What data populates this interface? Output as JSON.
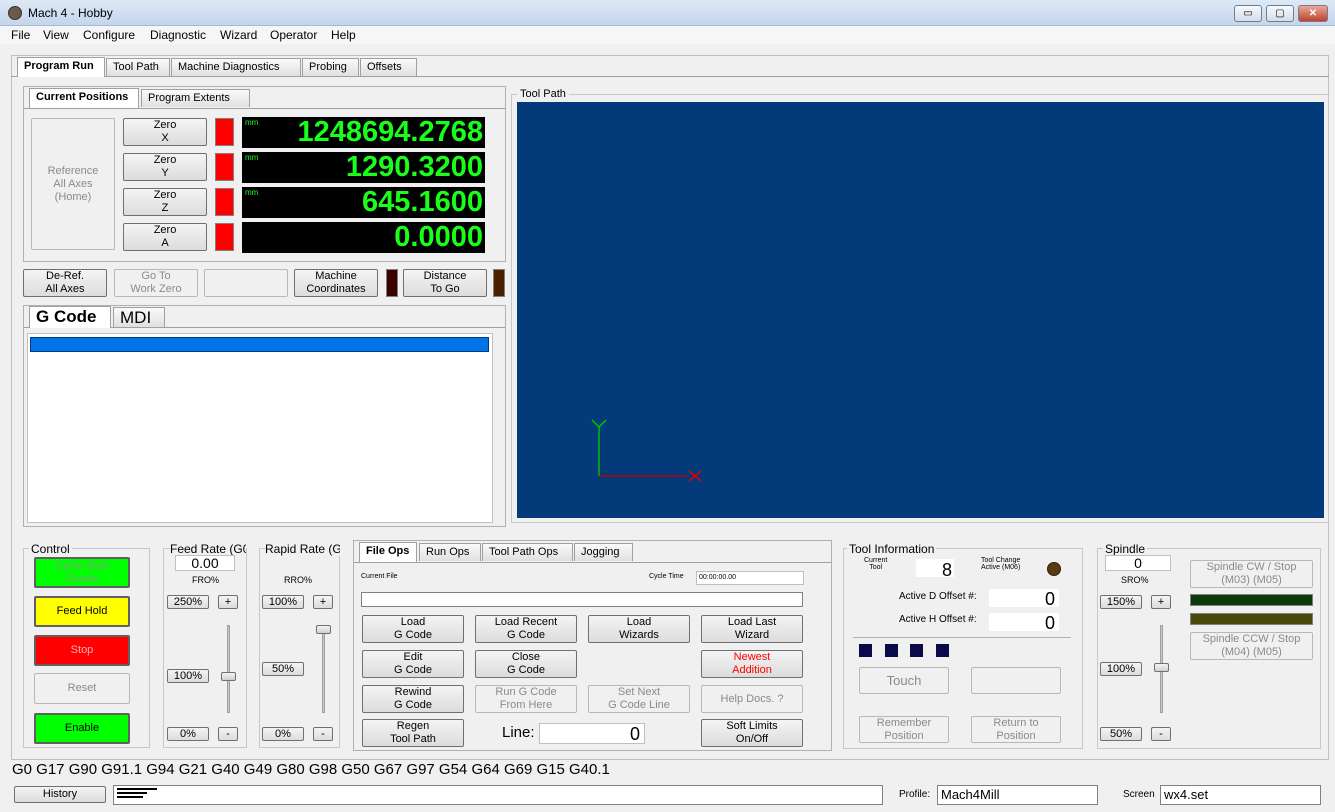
{
  "window": {
    "title": "Mach 4 - Hobby",
    "min": "▭",
    "max": "▢",
    "close": "✕"
  },
  "menu": [
    "File",
    "View",
    "Configure",
    "Diagnostic",
    "Wizard",
    "Operator",
    "Help"
  ],
  "main_tabs": [
    "Program Run",
    "Tool Path",
    "Machine Diagnostics",
    "Probing",
    "Offsets"
  ],
  "positions": {
    "tabs": [
      "Current Positions",
      "Program Extents"
    ],
    "reference_btn": "Reference\nAll Axes\n(Home)",
    "axes": [
      {
        "zero": "Zero\nX",
        "unit": "mm",
        "value": "1248694.2768"
      },
      {
        "zero": "Zero\nY",
        "unit": "mm",
        "value": "1290.3200"
      },
      {
        "zero": "Zero\nZ",
        "unit": "mm",
        "value": "645.1600"
      },
      {
        "zero": "Zero\nA",
        "unit": "",
        "value": "0.0000"
      }
    ],
    "deref": "De-Ref.\nAll Axes",
    "goto": "Go To\nWork Zero",
    "machine": "Machine\nCoordinates",
    "distance": "Distance\nTo Go"
  },
  "gcode": {
    "tabs": [
      "G Code",
      "MDI"
    ]
  },
  "toolpath_label": "Tool Path",
  "colors": {
    "toolpath_bg": "#033b7a",
    "dro_text": "#1aff1a"
  },
  "control": {
    "title": "Control",
    "cycle": "Cycle Start\nGcode",
    "hold": "Feed Hold",
    "stop": "Stop",
    "reset": "Reset",
    "enable": "Enable"
  },
  "feed": {
    "title": "Feed Rate (G0",
    "value": "0.00",
    "unit": "FRO%",
    "max": "250%",
    "mid": "100%",
    "min": "0%",
    "plus": "+",
    "minus": "-"
  },
  "rapid": {
    "title": "Rapid Rate (G",
    "unit": "RRO%",
    "max": "100%",
    "mid": "50%",
    "min": "0%",
    "plus": "+",
    "minus": "-"
  },
  "fileops": {
    "tabs": [
      "File Ops",
      "Run Ops",
      "Tool Path Ops",
      "Jogging"
    ],
    "current_file": "Current File",
    "cycle_time": "Cycle Time",
    "cycle_value": "00:00:00.00",
    "load": "Load\nG Code",
    "load_recent": "Load Recent\nG Code",
    "load_wizards": "Load\nWizards",
    "load_last": "Load Last\nWizard",
    "edit": "Edit\nG Code",
    "close": "Close\nG Code",
    "newest": "Newest\nAddition",
    "rewind": "Rewind\nG Code",
    "run_from": "Run G Code\nFrom Here",
    "set_next": "Set Next\nG Code Line",
    "help": "Help Docs. ?",
    "regen": "Regen\nTool Path",
    "line_label": "Line:",
    "line_value": "0",
    "soft_limits": "Soft Limits\nOn/Off"
  },
  "tool": {
    "title": "Tool Information",
    "current_label": "Current\nTool",
    "current_value": "8",
    "change_label": "Tool Change\nActive (M06)",
    "d_label": "Active D Offset #:",
    "d_value": "0",
    "h_label": "Active H Offset #:",
    "h_value": "0",
    "touch": "Touch",
    "remember": "Remember\nPosition",
    "return": "Return to\nPosition"
  },
  "spindle": {
    "title": "Spindle",
    "value": "0",
    "unit": "SRO%",
    "max": "150%",
    "mid": "100%",
    "min": "50%",
    "plus": "+",
    "minus": "-",
    "cw": "Spindle CW / Stop\n(M03)          (M05)",
    "ccw": "Spindle CCW / Stop\n(M04)          (M05)"
  },
  "modal_line": "G0 G17 G90 G91.1 G94 G21 G40 G49 G80 G98 G50 G67 G97 G54 G64 G69 G15 G40.1",
  "status": {
    "history": "History",
    "profile_label": "Profile:",
    "profile_value": "Mach4Mill",
    "screen_label": "Screen",
    "screen_value": "wx4.set"
  }
}
